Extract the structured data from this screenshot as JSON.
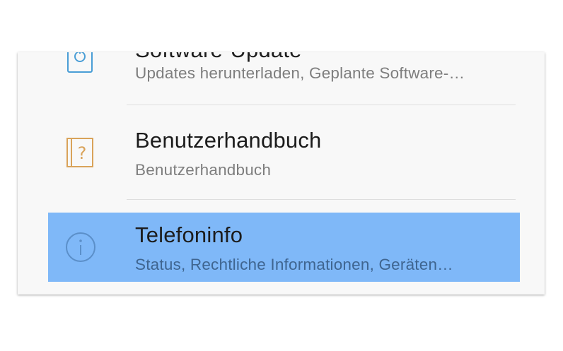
{
  "settings": {
    "items": [
      {
        "title": "Software-Update",
        "subtitle": "Updates herunterladen, Geplante Software-…",
        "icon": "software-update-icon",
        "icon_color": "#4a9ed6"
      },
      {
        "title": "Benutzerhandbuch",
        "subtitle": "Benutzerhandbuch",
        "icon": "user-manual-icon",
        "icon_color": "#d9a35a"
      },
      {
        "title": "Telefoninfo",
        "subtitle": "Status, Rechtliche Informationen, Geräten…",
        "icon": "info-icon",
        "icon_color": "#5b8fc9",
        "selected": true
      }
    ],
    "selection_color": "#7fb8f8"
  }
}
